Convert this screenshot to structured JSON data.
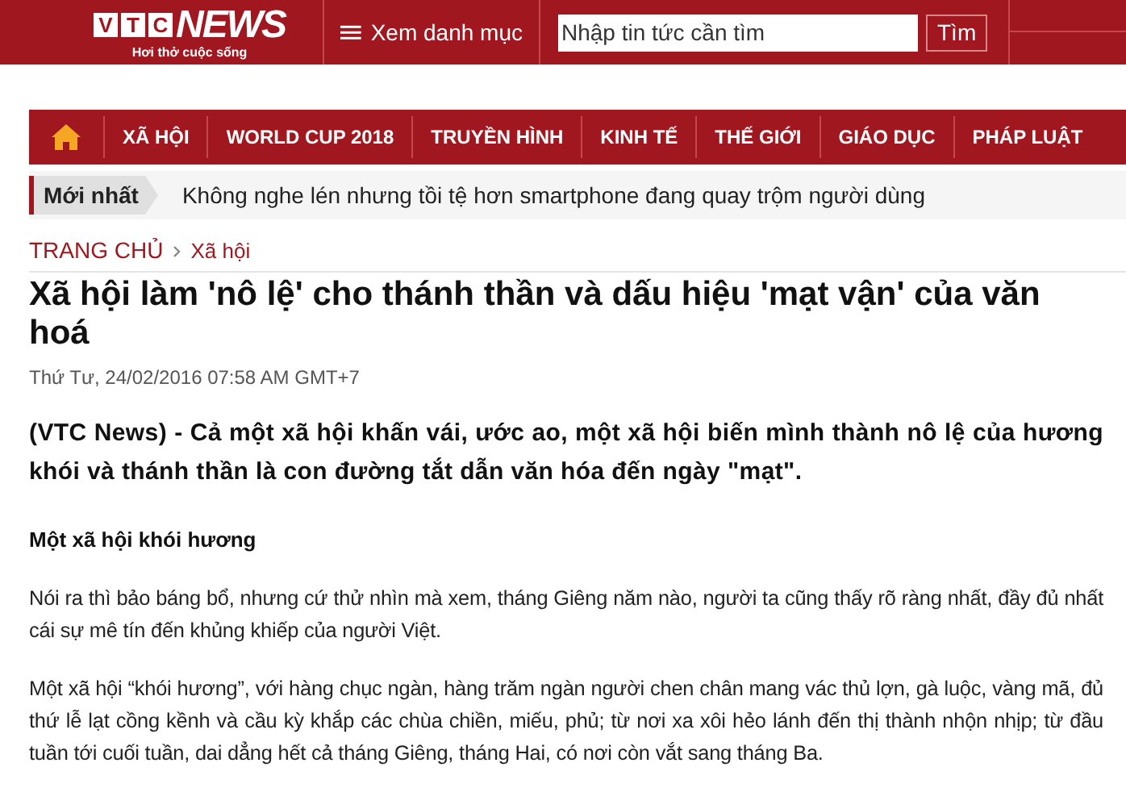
{
  "header": {
    "logo": {
      "letters": [
        "V",
        "T",
        "C"
      ],
      "word": "NEWS",
      "tagline": "Hơi thở cuộc sống"
    },
    "menu_label": "Xem danh mục",
    "search": {
      "placeholder": "Nhập tin tức cần tìm",
      "button": "Tìm"
    }
  },
  "nav": {
    "items": [
      {
        "label": "XÃ HỘI",
        "selected": false
      },
      {
        "label": "WORLD CUP 2018",
        "selected": false
      },
      {
        "label": "TRUYỀN HÌNH",
        "selected": false
      },
      {
        "label": "KINH TẾ",
        "selected": false
      },
      {
        "label": "THẾ GIỚI",
        "selected": false
      },
      {
        "label": "GIÁO DỤC",
        "selected": false
      },
      {
        "label": "PHÁP LUẬT",
        "selected": false
      }
    ]
  },
  "latest": {
    "label": "Mới nhất",
    "headline": "Không nghe lén nhưng tồi tệ hơn smartphone đang quay trộm người dùng"
  },
  "breadcrumb": [
    "TRANG CHỦ",
    "Xã hội"
  ],
  "article": {
    "title": "Xã hội làm 'nô lệ' cho thánh thần và dấu hiệu 'mạt vận' của văn hoá",
    "date": "Thứ Tư, 24/02/2016 07:58 AM GMT+7",
    "lead": "(VTC News) - Cả một xã hội khấn vái, ước ao, một xã hội biến mình thành nô lệ của hương khói và thánh thần là con đường tắt dẫn văn hóa đến ngày \"mạt\".",
    "blocks": [
      {
        "kind": "subheading",
        "text": "Một xã hội khói hương"
      },
      {
        "kind": "paragraph",
        "text": "Nói ra thì bảo báng bổ, nhưng cứ thử nhìn mà xem, tháng Giêng năm nào, người ta cũng thấy rõ ràng nhất, đầy đủ nhất cái sự mê tín đến khủng khiếp của người Việt."
      },
      {
        "kind": "paragraph",
        "text": "Một xã hội “khói hương”, với hàng chục ngàn, hàng trăm ngàn người chen chân mang vác thủ lợn, gà luộc, vàng mã, đủ thứ lễ lạt cồng kềnh và cầu kỳ khắp các chùa chiền, miếu, phủ; từ nơi xa xôi hẻo lánh đến thị thành nhộn nhịp; từ đầu tuần tới cuối tuần, dai dẳng hết cả tháng Giêng, tháng Hai, có nơi còn vắt sang tháng Ba."
      }
    ]
  }
}
